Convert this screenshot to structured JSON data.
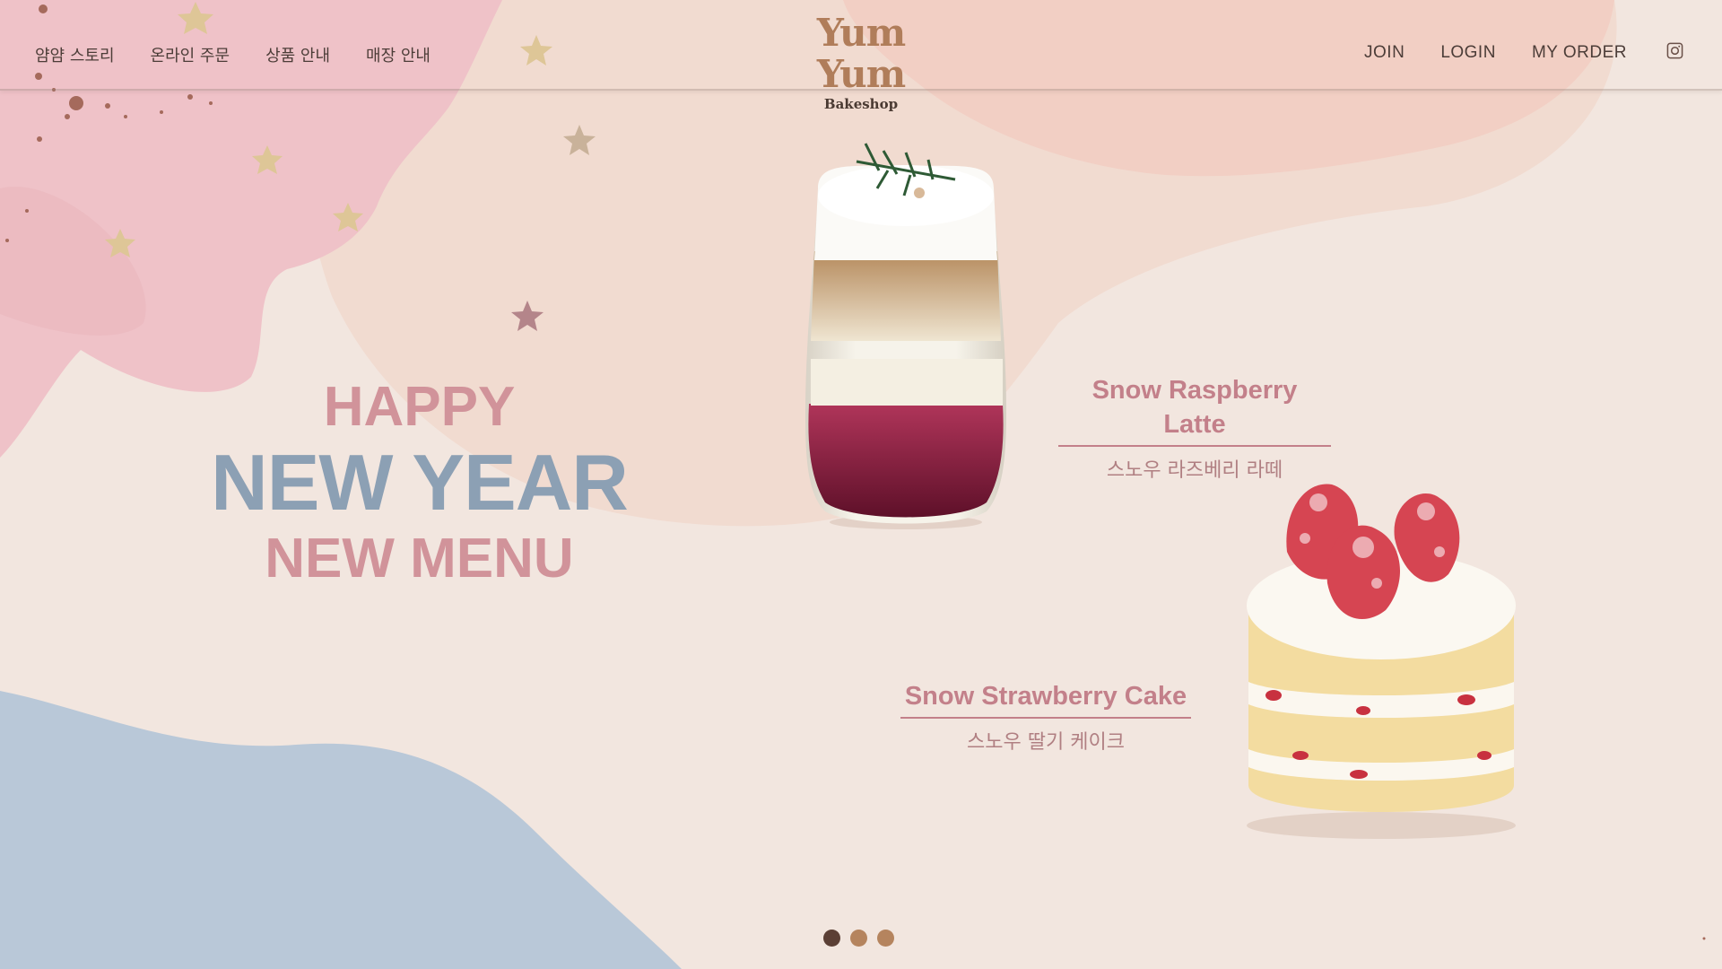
{
  "nav": {
    "left_items": [
      "얌얌 스토리",
      "온라인 주문",
      "상품 안내",
      "매장 안내"
    ],
    "right_items": [
      "JOIN",
      "LOGIN",
      "MY ORDER"
    ],
    "instagram_icon": "instagram-icon"
  },
  "logo": {
    "title": "Yum Yum",
    "subtitle": "Bakeshop"
  },
  "hero": {
    "line1": "HAPPY",
    "line2": "NEW YEAR",
    "line3": "NEW MENU"
  },
  "products": [
    {
      "name_en": "Snow Raspberry Latte",
      "name_ko": "스노우 라즈베리 라떼"
    },
    {
      "name_en": "Snow Strawberry Cake",
      "name_ko": "스노우 딸기 케이크"
    }
  ],
  "slider": {
    "total": 3,
    "active_index": 0
  },
  "colors": {
    "background": "#f2e6df",
    "pink_accent": "#d1939a",
    "blue_accent": "#8ca0b4",
    "label_color": "#c3808a",
    "dot_active": "#5b3f35",
    "dot_inactive": "#b5845e"
  }
}
